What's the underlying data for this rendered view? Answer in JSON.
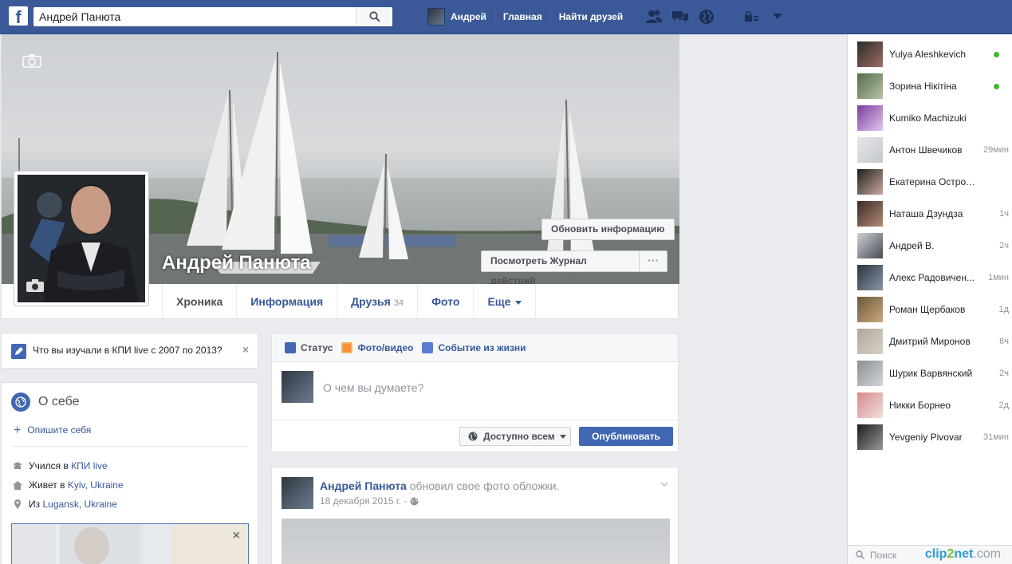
{
  "topbar": {
    "logo": "f",
    "search_value": "Андрей Панюта",
    "user_label": "Андрей",
    "home_label": "Главная",
    "find_friends_label": "Найти друзей"
  },
  "profile": {
    "name": "Андрей Панюта",
    "update_info_label": "Обновить информацию",
    "activity_log_label": "Посмотреть Журнал действий",
    "more_label": "···",
    "tabs": {
      "timeline": "Хроника",
      "about": "Информация",
      "friends": "Друзья",
      "friends_count": "34",
      "photos": "Фото",
      "more": "Еще"
    }
  },
  "study_prompt": {
    "text": "Что вы изучали в КПИ live с 2007 по 2013?",
    "close": "×"
  },
  "about": {
    "title": "О себе",
    "describe_label": "Опишите себя",
    "studied_prefix": "Учился в ",
    "studied_place": "КПИ live",
    "lives_prefix": "Живет в ",
    "lives_place": "Kyiv, Ukraine",
    "from_prefix": "Из ",
    "from_place": "Lugansk, Ukraine",
    "close": "×"
  },
  "composer": {
    "tab_status": "Статус",
    "tab_photo": "Фото/видео",
    "tab_event": "Событие из жизни",
    "placeholder": "О чем вы думаете?",
    "audience_label": "Доступно всем",
    "publish_label": "Опубликовать"
  },
  "post": {
    "author": "Андрей Панюта",
    "action": " обновил свое фото обложки.",
    "date": "18 декабря 2015 г. ·"
  },
  "chat": {
    "contacts": [
      {
        "name": "Yulya Aleshkevich",
        "time": "",
        "online": true
      },
      {
        "name": "Зорина Нікітіна",
        "time": "",
        "online": true
      },
      {
        "name": "Kumiko Machizuki",
        "time": "",
        "online": false
      },
      {
        "name": "Антон Швечиков",
        "time": "29мин",
        "online": false
      },
      {
        "name": "Екатерина Остроумова",
        "time": "",
        "online": false
      },
      {
        "name": "Наташа Дзундза",
        "time": "1ч",
        "online": false
      },
      {
        "name": "Андрей В.",
        "time": "2ч",
        "online": false
      },
      {
        "name": "Алекс Радовичен...",
        "time": "1мин",
        "online": false
      },
      {
        "name": "Роман Щербаков",
        "time": "1д",
        "online": false
      },
      {
        "name": "Дмитрий Миронов",
        "time": "6ч",
        "online": false
      },
      {
        "name": "Шурик Варвянский",
        "time": "2ч",
        "online": false
      },
      {
        "name": "Никки Борнео",
        "time": "2д",
        "online": false
      },
      {
        "name": "Yevgeniy Pivovar",
        "time": "31мин",
        "online": false
      }
    ],
    "search_label": "Поиск"
  },
  "watermark": {
    "part1": "clip",
    "part2": "2",
    "part3": "net",
    "part4": ".com"
  },
  "colors": {
    "brand": "#3b5998",
    "link": "#365899",
    "button": "#4267b2",
    "online": "#42b72a"
  }
}
